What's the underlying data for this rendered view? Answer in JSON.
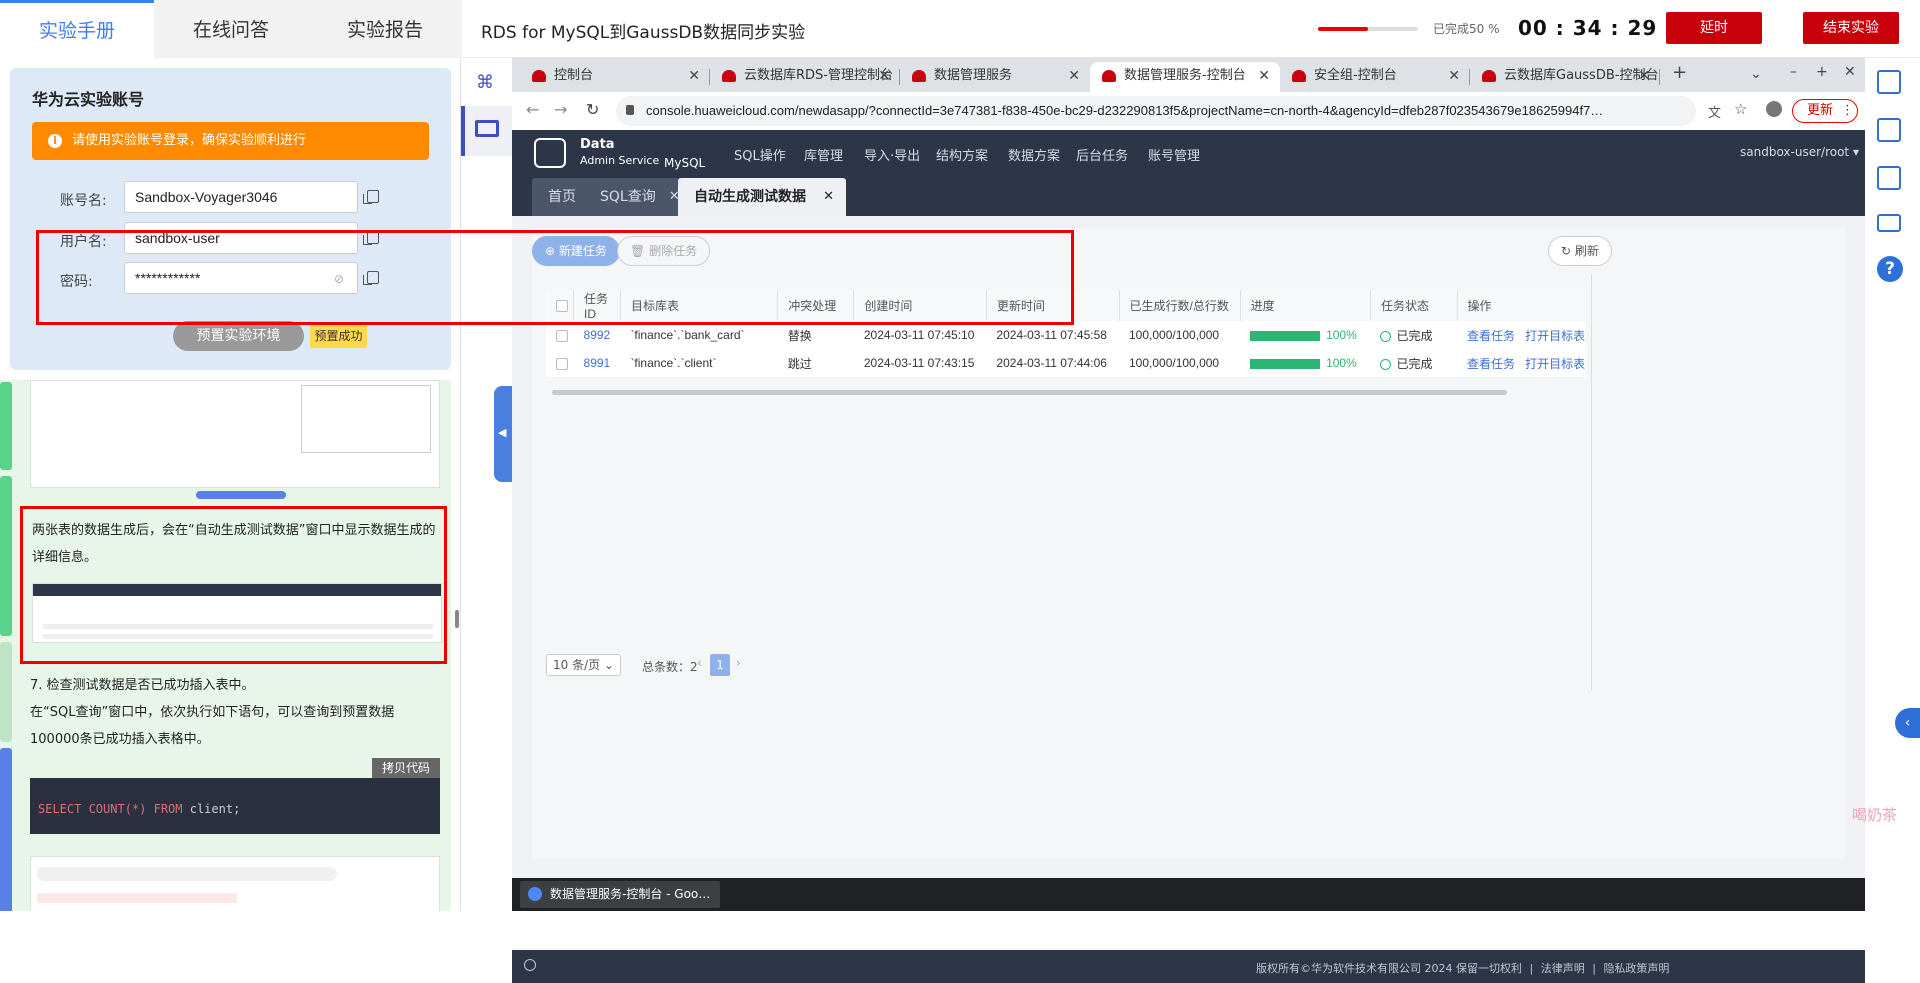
{
  "topbar": {
    "tabs": [
      "实验手册",
      "在线问答",
      "实验报告"
    ],
    "title": "RDS for MySQL到GaussDB数据同步实验",
    "progress_percent": 50,
    "progress_text": "已完成50 %",
    "timer": "00 : 34 : 29",
    "delay_label": "延时",
    "end_label": "结束实验"
  },
  "account": {
    "title": "华为云实验账号",
    "warning": "请使用实验账号登录，确保实验顺利进行",
    "account_label": "账号名:",
    "account_value": "Sandbox-Voyager3046",
    "user_label": "用户名:",
    "user_value": "sandbox-user",
    "password_label": "密码:",
    "password_value": "************",
    "preset_button": "预置实验环境",
    "preset_status": "预置成功"
  },
  "doc": {
    "para1": "两张表的数据生成后，会在“自动生成测试数据”窗口中显示数据生成的详细信息。",
    "step7_title": "7. 检查测试数据是否已成功插入表中。",
    "step7_body": "在“SQL查询”窗口中，依次执行如下语句，可以查询到预置数据100000条已成功插入表格中。",
    "copy_code": "拷贝代码",
    "code_kw": "SELECT COUNT(*) FROM",
    "code_rest": " client;"
  },
  "browser": {
    "tabs": [
      "控制台",
      "云数据库RDS-管理控制台",
      "数据管理服务",
      "数据管理服务-控制台",
      "安全组-控制台",
      "云数据库GaussDB-控制台"
    ],
    "active_tab_index": 3,
    "url": "console.huaweicloud.com/newdasapp/?connectId=3e747381-f838-450e-bc29-d232290813f5&projectName=cn-north-4&agencyId=dfeb287f023543679e18625994f7…",
    "update_label": "更新"
  },
  "app": {
    "brand_line1": "Data",
    "brand_line2": "Admin Service",
    "brand_db": "MySQL",
    "nav": [
      "SQL操作",
      "库管理",
      "导入·导出",
      "结构方案",
      "数据方案",
      "后台任务",
      "账号管理"
    ],
    "user": "sandbox-user/root",
    "tabs": [
      "首页",
      "SQL查询",
      "自动生成测试数据"
    ],
    "new_task": "新建任务",
    "delete_task": "删除任务",
    "refresh": "刷新",
    "columns": [
      "任务ID",
      "目标库表",
      "冲突处理",
      "创建时间",
      "更新时间",
      "已生成行数/总行数",
      "进度",
      "任务状态",
      "操作"
    ],
    "rows": [
      {
        "id": "8992",
        "table": "`finance`.`bank_card`",
        "conflict": "替换",
        "created": "2024-03-11 07:45:10",
        "updated": "2024-03-11 07:45:58",
        "rows": "100,000/100,000",
        "progress": 100,
        "progress_text": "100%",
        "status": "已完成",
        "op1": "查看任务",
        "op2": "打开目标表"
      },
      {
        "id": "8991",
        "table": "`finance`.`client`",
        "conflict": "跳过",
        "created": "2024-03-11 07:43:15",
        "updated": "2024-03-11 07:44:06",
        "rows": "100,000/100,000",
        "progress": 100,
        "progress_text": "100%",
        "status": "已完成",
        "op1": "查看任务",
        "op2": "打开目标表"
      }
    ],
    "page_size": "10 条/页",
    "total": "总条数：2",
    "page": "1",
    "footer_copyright": "版权所有©华为软件技术有限公司 2024 保留一切权利",
    "footer_legal": "法律声明",
    "footer_privacy": "隐私政策声明"
  },
  "taskbar": {
    "item": "数据管理服务-控制台 - Goo…"
  },
  "watermark": "喝奶茶"
}
